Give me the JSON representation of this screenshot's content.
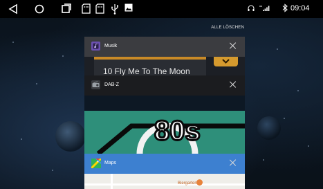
{
  "status_bar": {
    "time": "09:04",
    "icons": [
      "back-icon",
      "home-icon",
      "recents-icon",
      "sd-card-icon",
      "sd-card-2-icon",
      "usb-icon",
      "image-icon",
      "headset-icon",
      "signal-icon",
      "bluetooth-icon"
    ]
  },
  "recents": {
    "clear_all_label": "ALLE LÖSCHEN",
    "cards": [
      {
        "title": "Musik",
        "preview_text": "10 Fly Me To The Moon",
        "accent": "#d59a2e"
      },
      {
        "title": "DAB-Z",
        "preview_text": "80s",
        "accent": "#2e8f7a"
      },
      {
        "title": "Maps",
        "preview_text": "Biergarten",
        "accent": "#3d80d0"
      }
    ]
  }
}
